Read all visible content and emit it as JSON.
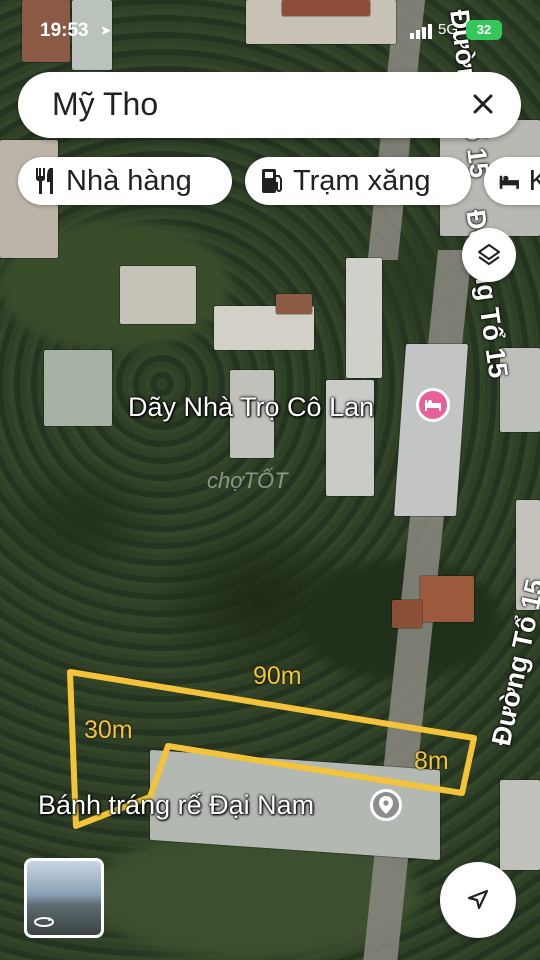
{
  "status_bar": {
    "time": "19:53",
    "network": "5G",
    "battery": "32"
  },
  "search": {
    "query": "Mỹ Tho"
  },
  "chips": [
    {
      "label": "Nhà hàng",
      "icon": "restaurant-icon"
    },
    {
      "label": "Trạm xăng",
      "icon": "gas-station-icon"
    },
    {
      "label": "K",
      "icon": "hotel-icon"
    }
  ],
  "map": {
    "places": [
      {
        "name": "Dãy Nhà Trọ Cô Lan",
        "icon": "lodging-icon",
        "color": "#e8609a"
      },
      {
        "name": "Bánh tráng rế Đại Nam",
        "icon": "place-pin-icon",
        "color": "#8a8d91"
      }
    ],
    "roads": [
      {
        "name": "Đường Tổ 15"
      },
      {
        "name": "Đường Tổ 15"
      },
      {
        "name": "Đường Tổ 15"
      }
    ],
    "plot": {
      "outline_color": "#f3c43a",
      "dimensions": {
        "top": "90m",
        "left": "30m",
        "right": "8m"
      }
    },
    "watermark": "chợTỐT"
  },
  "buttons": {
    "layers": "layers-icon",
    "navigate": "navigate-arrow-icon",
    "street_view": "street-view-thumbnail"
  }
}
